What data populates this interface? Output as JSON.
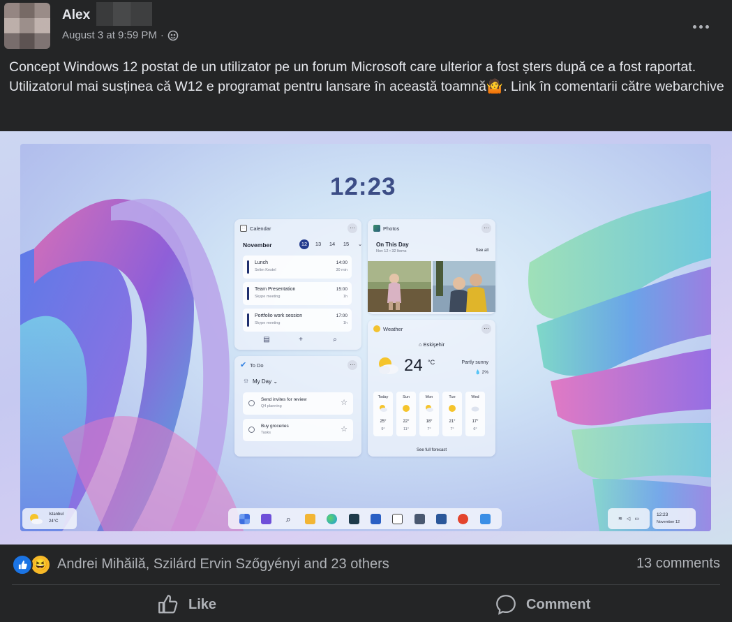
{
  "post": {
    "author": "Alex",
    "timestamp": "August 3 at 9:59 PM",
    "meta_separator": "·",
    "audience_icon": "globe-icon",
    "more_icon": "more-dots-icon",
    "text": "Concept Windows 12 postat de un utilizator pe un forum Microsoft care ulterior a fost șters după ce a fost raportat. Utilizatorul mai susținea că W12 e programat pentru lansare în această toamnă🤷. Link în comentarii către webarchive"
  },
  "screenshot": {
    "clock": "12:23",
    "calendar": {
      "title": "Calendar",
      "month": "November",
      "days": [
        "12",
        "13",
        "14",
        "15"
      ],
      "selected_day": "12",
      "events": [
        {
          "title": "Lunch",
          "sub": "Selim Kestel",
          "time": "14:00",
          "duration": "30 min"
        },
        {
          "title": "Team Presentation",
          "sub": "Skype meeting",
          "time": "15:00",
          "duration": "1h"
        },
        {
          "title": "Portfolio work session",
          "sub": "Skype meeting",
          "time": "17:00",
          "duration": "1h"
        }
      ]
    },
    "photos": {
      "title": "Photos",
      "heading": "On This Day",
      "sub": "Nov 12 • 32 Items",
      "see_all": "See all"
    },
    "weather": {
      "title": "Weather",
      "city": "Eskişehir",
      "temp": "24",
      "unit": "°C",
      "condition": "Partly sunny",
      "rain": "💧 2%",
      "forecast": [
        {
          "day": "Today",
          "hi": "25°",
          "lo": "9°",
          "icon": "partly-cloudy"
        },
        {
          "day": "Sun",
          "hi": "22°",
          "lo": "11°",
          "icon": "sunny"
        },
        {
          "day": "Mon",
          "hi": "18°",
          "lo": "7°",
          "icon": "partly-cloudy"
        },
        {
          "day": "Tue",
          "hi": "21°",
          "lo": "7°",
          "icon": "sunny"
        },
        {
          "day": "Wed",
          "hi": "17°",
          "lo": "6°",
          "icon": "cloudy"
        }
      ],
      "see_full": "See full forecast"
    },
    "todo": {
      "title": "To Do",
      "list_name": "My Day",
      "tasks": [
        {
          "title": "Send invites for review",
          "sub": "Q4 planning"
        },
        {
          "title": "Buy groceries",
          "sub": "Tasks"
        }
      ]
    },
    "taskbar": {
      "weather_city": "Istanbul",
      "weather_temp": "24°C",
      "time": "12:23",
      "date": "November 12",
      "colors": {
        "start": "#3d6ee0",
        "widgets": "#6e4fd9",
        "search": "#2a2f45",
        "explorer": "#f2b534",
        "edge": "#1c9ce0",
        "terminal": "#1e3a4a",
        "mail": "#2a5fc4",
        "word": "#2b579a",
        "office": "#e3442d",
        "store": "#3a8ee6"
      }
    }
  },
  "reactions": {
    "like_icon": "thumbs-up-icon",
    "haha_icon": "😆",
    "names": "Andrei Mihăilă, Szilárd Ervin Szőgyényi and 23 others",
    "comments_count": "13 comments"
  },
  "actions": {
    "like_label": "Like",
    "comment_label": "Comment"
  },
  "colors": {
    "background": "#242526",
    "text_primary": "#e4e6eb",
    "text_secondary": "#b0b3b8",
    "like_blue": "#1b74e4"
  }
}
